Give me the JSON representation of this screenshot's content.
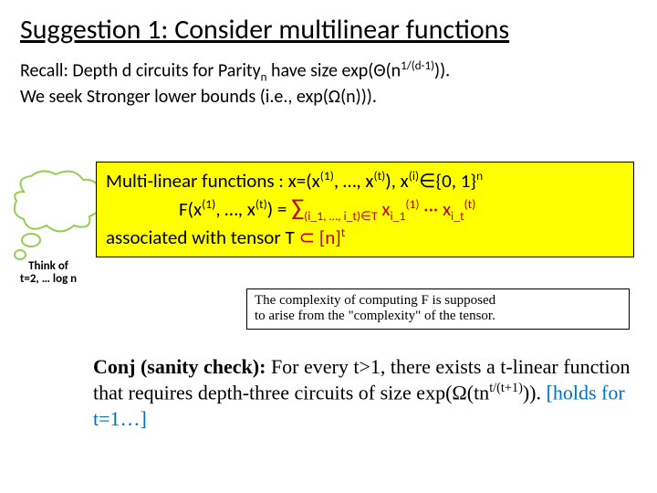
{
  "title": "Suggestion 1: Consider multilinear functions",
  "recall": {
    "line1_a": "Recall: Depth d circuits for Parity",
    "line1_b": " have size exp(Θ(n",
    "line1_c": ")).",
    "line2": "We seek Stronger lower bounds (i.e., exp(Ω(n)))."
  },
  "highlight": {
    "l1_a": "Multi-linear functions :   x=(x",
    "l1_b": ", …, x",
    "l1_c": "),   x",
    "l1_d": "∈{0, 1}",
    "l2_a": "F(x",
    "l2_b": ", …, x",
    "l2_c": ") = ",
    "l2_sum": "∑",
    "l2_sub": "(i_1, …, i_t)∈T",
    "l2_d": " x",
    "l2_e": " ··· x",
    "l3_a": "associated with tensor  T ",
    "l3_b": "⊂",
    "l3_c": " [n]",
    "sup1": "(1)",
    "supt": "(t)",
    "supi": "(i)",
    "supn": "n",
    "supt_only": "t",
    "sub_n": "n",
    "sub_i1": "i_1",
    "sub_it": "i_t",
    "exp_d": "1/(d-1)"
  },
  "thought": {
    "l1": "Think of",
    "l2": "t=2, … log n"
  },
  "complexity": {
    "l1": "The complexity of computing F is supposed",
    "l2": "to arise from the \"complexity\" of the tensor."
  },
  "conj": {
    "p1": "Conj (sanity check): ",
    "p2": "For every t>1, there exists a t-linear function that requires depth-three circuits of size exp(Ω(tn",
    "p3": ")).  ",
    "p4": "[holds for t=1…]",
    "exp": "t/(t+1)"
  }
}
